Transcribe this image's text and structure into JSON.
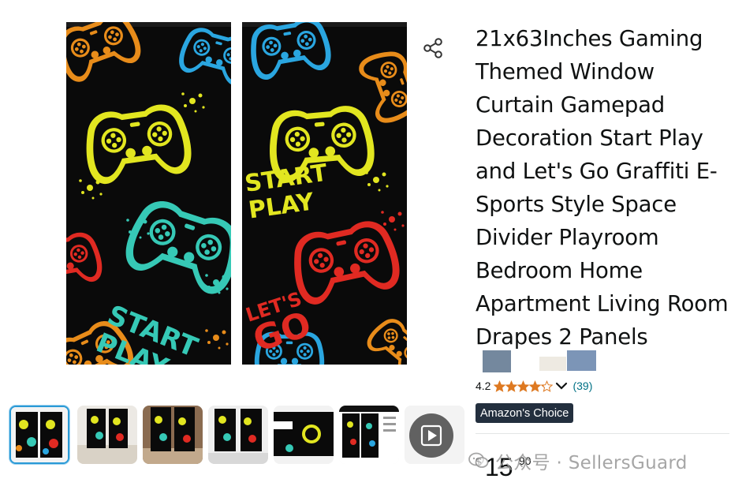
{
  "product": {
    "title": "21x63Inches Gaming Themed Window Curtain Gamepad Decoration Start Play and Let's Go Graffiti E-Sports Style Space Divider Playroom Bedroom Home Apartment Living Room Drapes 2 Panels",
    "image_text": {
      "start": "START",
      "play": "PLAY",
      "lets": "LET'S",
      "go": "GO"
    }
  },
  "rating": {
    "value": "4.2",
    "stars": 4.2,
    "review_count": "(39)"
  },
  "badge": {
    "label": "Amazon's Choice"
  },
  "price": {
    "currency": "$",
    "whole": "15",
    "fraction": "90"
  },
  "watermark": {
    "text": "公众号 · SellersGuard"
  },
  "icons": {
    "share": "share-icon",
    "chevron": "chevron-down-icon",
    "play": "play-icon",
    "star": "star-icon"
  },
  "thumbnails": [
    {
      "kind": "image",
      "selected": true
    },
    {
      "kind": "image",
      "selected": false
    },
    {
      "kind": "image",
      "selected": false
    },
    {
      "kind": "image",
      "selected": false
    },
    {
      "kind": "image",
      "selected": false
    },
    {
      "kind": "image",
      "selected": false
    },
    {
      "kind": "video",
      "selected": false
    }
  ],
  "colors": {
    "star": "#de7921",
    "link": "#007185",
    "badge_bg": "#232f3e",
    "selected_border": "#2a9ad6",
    "curtain_bg": "#0a0a0a",
    "yellow": "#e2e620",
    "cyan": "#36c9b6",
    "blue": "#2aa6e0",
    "red": "#e02a22",
    "orange": "#e88c1a"
  }
}
